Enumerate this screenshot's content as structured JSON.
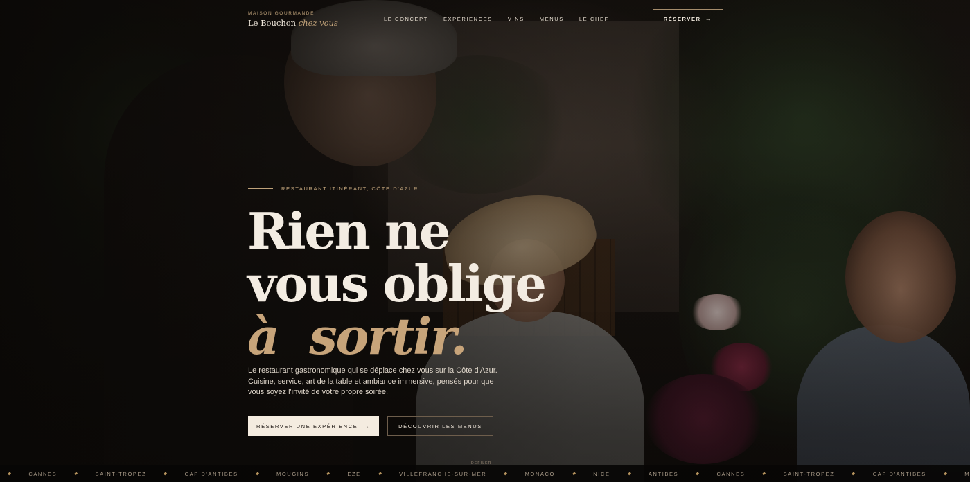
{
  "brand": {
    "kicker": "MAISON GOURMANDE",
    "name": "Le Bouchon",
    "name_accent": "chez vous"
  },
  "nav": {
    "items": [
      {
        "label": "LE CONCEPT"
      },
      {
        "label": "EXPÉRIENCES"
      },
      {
        "label": "VINS"
      },
      {
        "label": "MENUS"
      },
      {
        "label": "LE CHEF"
      }
    ],
    "reserve_label": "RÉSERVER",
    "reserve_icon": "arrow-right-icon"
  },
  "hero": {
    "eyebrow": "RESTAURANT ITINÉRANT, CÔTE D'AZUR",
    "headline_line1": "Rien ne",
    "headline_line2": "vous oblige",
    "headline_line3": "à  sortir.",
    "subtext": "Le restaurant gastronomique qui se déplace chez vous sur la Côte d'Azur. Cuisine, service, art de la table et ambiance immersive, pensés pour que vous soyez l'invité de votre propre soirée.",
    "primary_cta": "RÉSERVER UNE EXPÉRIENCE",
    "secondary_cta": "DÉCOUVRIR LES MENUS",
    "scroll_hint": "DÉFILER",
    "accent_color": "#c7a47a"
  },
  "ticker": {
    "items": [
      "CANNES",
      "SAINT-TROPEZ",
      "CAP D'ANTIBES",
      "MOUGINS",
      "ÈZE",
      "VILLEFRANCHE-SUR-MER",
      "MONACO",
      "NICE",
      "ANTIBES",
      "CANNES",
      "SAINT-TROPEZ",
      "CAP D'ANTIBES",
      "M"
    ]
  }
}
